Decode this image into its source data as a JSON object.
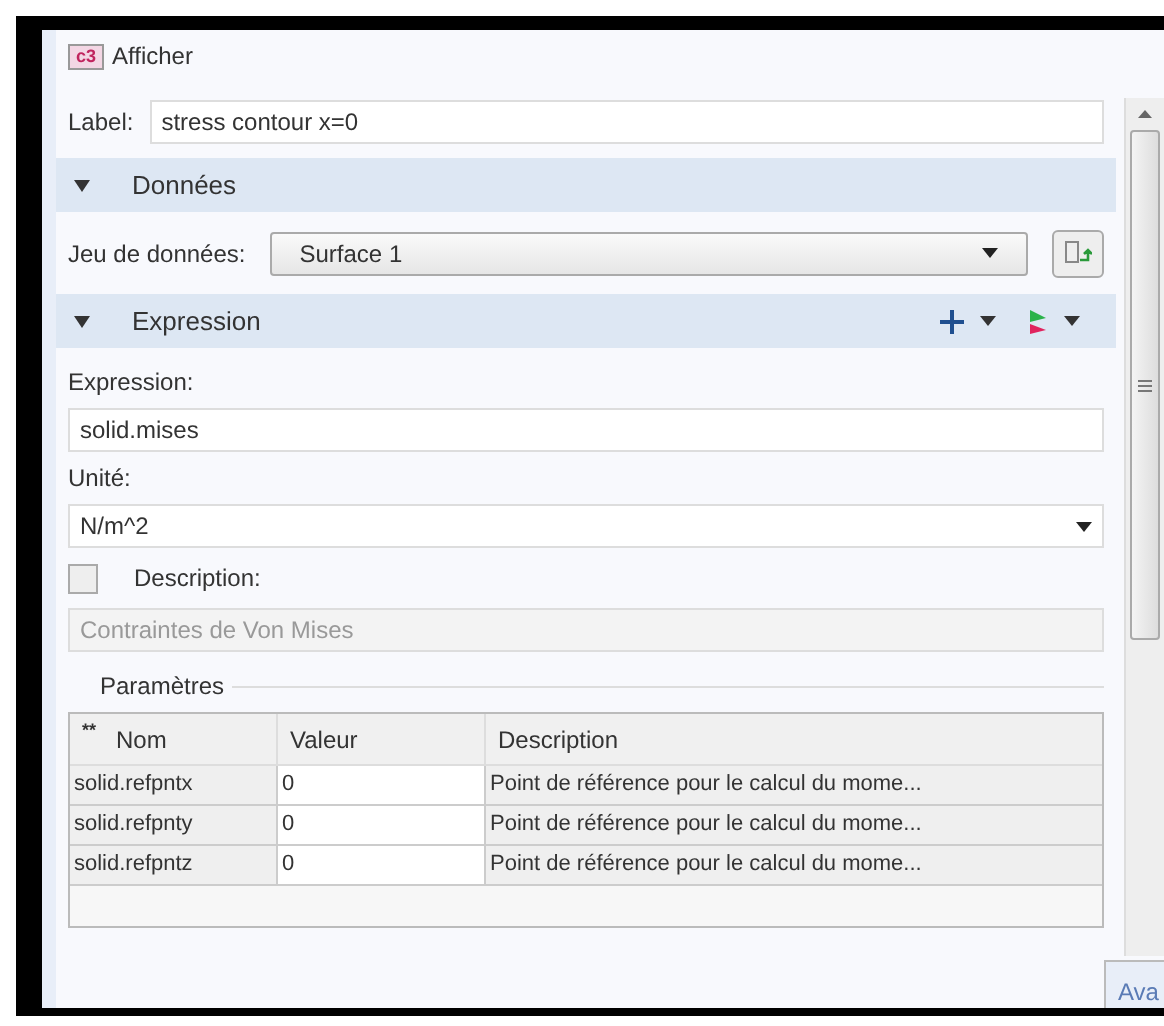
{
  "panel": {
    "title": "Afficher",
    "icon_text": "c3"
  },
  "label_field": {
    "label": "Label:",
    "value": "stress contour x=0"
  },
  "sections": [
    {
      "title": "Données",
      "expanded": true
    },
    {
      "title": "Expression",
      "expanded": true
    }
  ],
  "dataset": {
    "label": "Jeu de données:",
    "value": "Surface 1"
  },
  "expression": {
    "label": "Expression:",
    "value": "solid.mises"
  },
  "unit": {
    "label": "Unité:",
    "value": "N/m^2"
  },
  "description": {
    "label": "Description:",
    "checked": false,
    "value": "Contraintes de Von Mises"
  },
  "parameters": {
    "title": "Paramètres",
    "sort_mark": "**",
    "columns": [
      "Nom",
      "Valeur",
      "Description"
    ],
    "rows": [
      [
        "solid.refpntx",
        "0",
        "Point de référence pour le calcul du mome..."
      ],
      [
        "solid.refpnty",
        "0",
        "Point de référence pour le calcul du mome..."
      ],
      [
        "solid.refpntz",
        "0",
        "Point de référence pour le calcul du mome..."
      ]
    ]
  },
  "corner_tab": "Ava"
}
